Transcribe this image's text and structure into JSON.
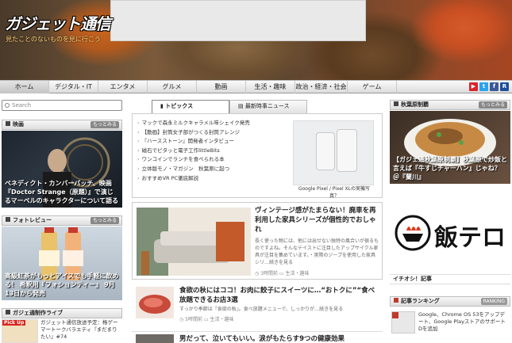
{
  "header": {
    "logo": "ガジェット通信",
    "tagline": "見たことのないものを見に行こう"
  },
  "nav": {
    "items": [
      "ホーム",
      "デジタル・IT",
      "エンタメ",
      "グルメ",
      "動画",
      "生活・趣味",
      "政治・経済・社会",
      "ゲーム"
    ],
    "social": [
      {
        "icon": "youtube-icon",
        "color": "#d9252a",
        "glyph": "▶"
      },
      {
        "icon": "twitter-icon",
        "color": "#2aa3ef",
        "glyph": "t"
      },
      {
        "icon": "facebook-icon",
        "color": "#3b5998",
        "glyph": "f"
      },
      {
        "icon": "rss-icon",
        "color": "#1d4f9a",
        "glyph": "R"
      }
    ]
  },
  "search": {
    "placeholder": "Search"
  },
  "left": {
    "movie": {
      "title": "映画",
      "more": "もっとみる",
      "caption": "ベネディクト・カンバーバッチ、映画『Doctor Strange（原題）』で演じるマーベルのキャラクターについて語る"
    },
    "photo": {
      "title": "フォトレビュー",
      "more": "もっとみる",
      "caption": "高級紅茶がもっとアイスでも手軽に飲める！ 希釈用『フォションティー』 9月13日から発売"
    },
    "live": {
      "title": "ガジェ通制作ライブ",
      "badge": "Pick Up",
      "text": "ガジェット通信放送予定：格ゲーマートークバラエティ『まだまりたい』#74"
    }
  },
  "center": {
    "tabs": [
      {
        "icon": "bookmark-icon",
        "label": "トピックス"
      },
      {
        "icon": "news-icon",
        "label": "最新時事ニュース"
      }
    ],
    "topics": [
      "マックで森永ミルクキャラメル味シェイク発売",
      "【動画】封筒女子部がつくる封筒アレンジ",
      "『ハースストーン』開発者インタビュー",
      "磁石でピタッと電子工作littleBits",
      "ワンコインでランチを食べられる本",
      "立体版モノ・マガジン　秋葉原に起つ",
      "おすすめVR PC徹底解説"
    ],
    "photo_caption": "Google Pixel / Pixel XLの実機写真？",
    "articles": [
      {
        "title": "ヴィンテージ感がたまらない！廃車を再利用した家具シリーズが個性的でおしゃれ",
        "body": "長く使った物には、他には出せない独特の風合いが宿るものですよね。そんなテイストに注目したアップサイクル家具が注目を集めています。・実際のジープを使用した家具シリ…続きを見る",
        "time": "3時間前",
        "category": "生活・趣味"
      },
      {
        "title": "食欲の秋にはココ！お肉に餃子にスイーツに…“おトクに”“食べ放題できるお店3選",
        "body": "すっかり季節は『食欲の秋』。食べ放題メニューで、しっかりが…続きを見る",
        "time": "5時間前",
        "category": "生活・趣味"
      },
      {
        "title": "男だって、泣いてもいい。涙がもたらす9つの健康効果"
      }
    ]
  },
  "right": {
    "akiba": {
      "title": "秋葉原制覇",
      "more": "もっとみる",
      "caption": "【ガジェ通秋葉原制覇】秋葉原で炒飯と言えば『牛すじチャーハン』じゃね？ ＠『蘭川』"
    },
    "meshi": {
      "logo": "飯テロ"
    },
    "pickup": {
      "title": "イチオシ！記事"
    },
    "ranking": {
      "title": "記事ランキング",
      "badge": "RANKING",
      "item": "Google、Chrome OS 53をアップデート、Google PlayストアのサポートDを追加"
    }
  }
}
